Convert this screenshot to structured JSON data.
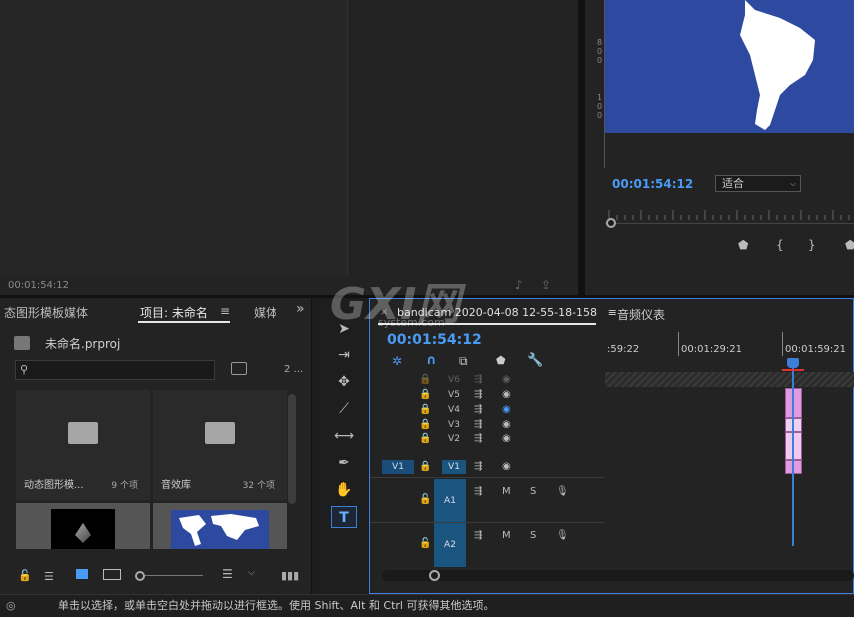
{
  "source": {
    "timecode": "00:01:54:12",
    "icons": [
      "export-frame-icon",
      "insert-icon"
    ]
  },
  "program": {
    "timecode": "00:01:54:12",
    "fit_label": "适合",
    "ruler_digits": [
      "8",
      "0",
      "0",
      "1",
      "0",
      "0"
    ],
    "buttons": [
      "marker-icon",
      "in-point-icon",
      "out-point-icon",
      "next-icon"
    ]
  },
  "project": {
    "tabs": [
      "态图形模板媒体",
      "项目: 未命名",
      "媒体"
    ],
    "menu_glyph": "≡",
    "overflow_glyph": "»",
    "file_name": "未命名.prproj",
    "item_count": "2 ...",
    "bins": [
      {
        "name": "动态图形模...",
        "count": "9 个项"
      },
      {
        "name": "音效库",
        "count": "32 个项"
      }
    ]
  },
  "tools": [
    "selection-tool",
    "track-select-tool",
    "ripple-edit-tool",
    "razor-tool",
    "slip-tool",
    "pen-tool",
    "hand-tool",
    "type-tool"
  ],
  "timeline": {
    "close": "×",
    "sequence_name": "bandicam 2020-04-08 12-55-18-158",
    "menu_glyph": "≡",
    "meter_tab": "音频仪表",
    "timecode": "00:01:54:12",
    "ruler_labels": [
      ":59:22",
      "00:01:29:21",
      "00:01:59:21"
    ],
    "video_tracks": [
      {
        "name": "V6",
        "dim": true
      },
      {
        "name": "V5"
      },
      {
        "name": "V4",
        "hidden": true
      },
      {
        "name": "V3"
      },
      {
        "name": "V2"
      },
      {
        "name": "V1"
      }
    ],
    "source_patch": "V1",
    "audio_tracks": [
      {
        "name": "A1",
        "m": "M",
        "s": "S"
      },
      {
        "name": "A2",
        "m": "M",
        "s": "S"
      }
    ]
  },
  "watermark": {
    "logo": "GXI网",
    "domain": "system.com"
  },
  "status_text": "单击以选择，或单击空白处并拖动以进行框选。使用 Shift、Alt 和 Ctrl 可获得其他选项。",
  "colors": {
    "accent": "#4a9bf5",
    "clip": "#e29ae0",
    "program_bg": "#2d4aa0"
  }
}
